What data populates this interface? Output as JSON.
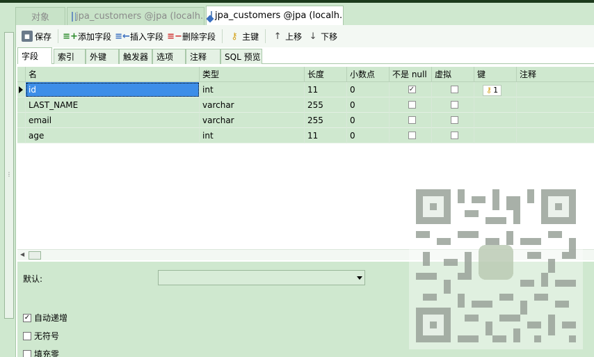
{
  "doc_tabs": [
    {
      "label": "对象"
    },
    {
      "label": "jpa_customers @jpa (localh...",
      "icon": "table-icon"
    },
    {
      "label": "jpa_customers @jpa (localh...",
      "icon": "table-design-icon",
      "active": true
    }
  ],
  "toolbar": {
    "save": "保存",
    "add_field": "添加字段",
    "insert_field": "插入字段",
    "delete_field": "删除字段",
    "primary_key": "主键",
    "move_up": "上移",
    "move_down": "下移"
  },
  "sub_tabs": [
    "字段",
    "索引",
    "外键",
    "触发器",
    "选项",
    "注释",
    "SQL 预览"
  ],
  "columns": [
    "名",
    "类型",
    "长度",
    "小数点",
    "不是 null",
    "虚拟",
    "键",
    "注释"
  ],
  "fields": [
    {
      "name": "id",
      "type": "int",
      "length": "11",
      "decimals": "0",
      "not_null": true,
      "virtual": false,
      "key": "1"
    },
    {
      "name": "LAST_NAME",
      "type": "varchar",
      "length": "255",
      "decimals": "0",
      "not_null": false,
      "virtual": false,
      "key": ""
    },
    {
      "name": "email",
      "type": "varchar",
      "length": "255",
      "decimals": "0",
      "not_null": false,
      "virtual": false,
      "key": ""
    },
    {
      "name": "age",
      "type": "int",
      "length": "11",
      "decimals": "0",
      "not_null": false,
      "virtual": false,
      "key": ""
    }
  ],
  "properties": {
    "default_label": "默认:",
    "default_value": "",
    "auto_increment_label": "自动递增",
    "auto_increment": true,
    "unsigned_label": "无符号",
    "unsigned": false,
    "zerofill_label": "填充零",
    "zerofill": false
  },
  "colors": {
    "row_bg": "#cfe8cf",
    "selected": "#3d8ee8",
    "key_icon": "#d4a017"
  }
}
